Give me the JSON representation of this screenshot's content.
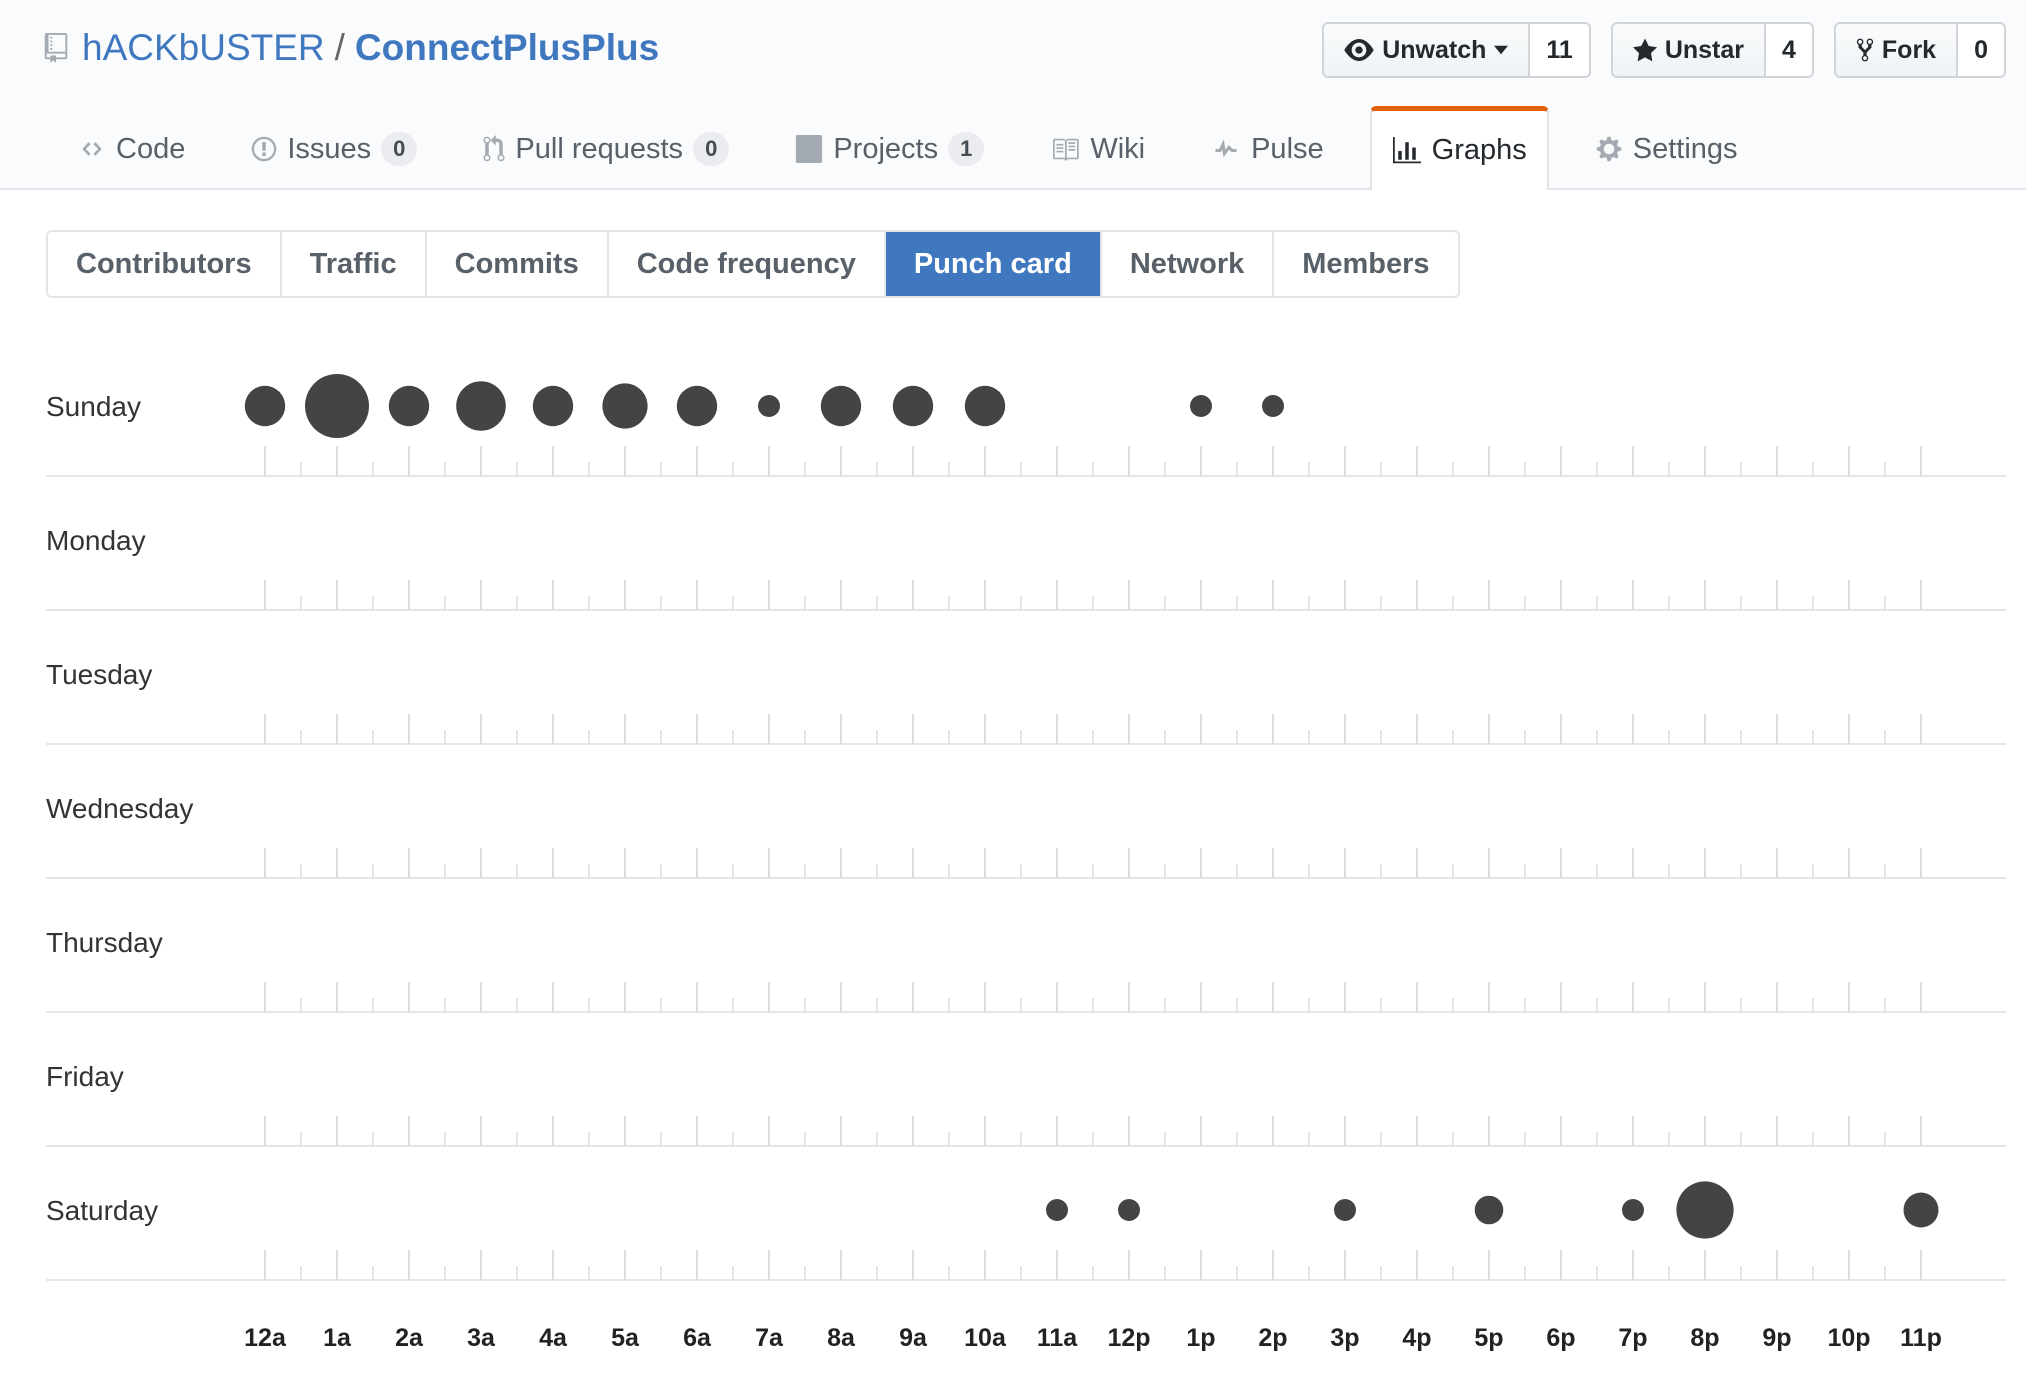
{
  "repo": {
    "owner": "hACKbUSTER",
    "separator": "/",
    "name": "ConnectPlusPlus"
  },
  "actions": {
    "watch": {
      "label": "Unwatch",
      "count": "11"
    },
    "star": {
      "label": "Unstar",
      "count": "4"
    },
    "fork": {
      "label": "Fork",
      "count": "0"
    }
  },
  "reponav": {
    "code": {
      "label": "Code"
    },
    "issues": {
      "label": "Issues",
      "count": "0"
    },
    "pulls": {
      "label": "Pull requests",
      "count": "0"
    },
    "projects": {
      "label": "Projects",
      "count": "1"
    },
    "wiki": {
      "label": "Wiki"
    },
    "pulse": {
      "label": "Pulse"
    },
    "graphs": {
      "label": "Graphs"
    },
    "settings": {
      "label": "Settings"
    }
  },
  "subnav": {
    "contributors": "Contributors",
    "traffic": "Traffic",
    "commits": "Commits",
    "code_frequency": "Code frequency",
    "punch_card": "Punch card",
    "network": "Network",
    "members": "Members"
  },
  "colors": {
    "link": "#4078c0",
    "accent": "#e36209",
    "selected": "#4078c0",
    "dot": "#444444"
  },
  "chart_data": {
    "type": "scatter",
    "days": [
      "Sunday",
      "Monday",
      "Tuesday",
      "Wednesday",
      "Thursday",
      "Friday",
      "Saturday"
    ],
    "hours": [
      "12a",
      "1a",
      "2a",
      "3a",
      "4a",
      "5a",
      "6a",
      "7a",
      "8a",
      "9a",
      "10a",
      "11a",
      "12p",
      "1p",
      "2p",
      "3p",
      "4p",
      "5p",
      "6p",
      "7p",
      "8p",
      "9p",
      "10p",
      "11p"
    ],
    "values": [
      [
        4,
        10,
        4,
        6,
        4,
        5,
        4,
        1,
        4,
        4,
        4,
        0,
        0,
        1,
        1,
        0,
        0,
        0,
        0,
        0,
        0,
        0,
        0,
        0
      ],
      [
        0,
        0,
        0,
        0,
        0,
        0,
        0,
        0,
        0,
        0,
        0,
        0,
        0,
        0,
        0,
        0,
        0,
        0,
        0,
        0,
        0,
        0,
        0,
        0
      ],
      [
        0,
        0,
        0,
        0,
        0,
        0,
        0,
        0,
        0,
        0,
        0,
        0,
        0,
        0,
        0,
        0,
        0,
        0,
        0,
        0,
        0,
        0,
        0,
        0
      ],
      [
        0,
        0,
        0,
        0,
        0,
        0,
        0,
        0,
        0,
        0,
        0,
        0,
        0,
        0,
        0,
        0,
        0,
        0,
        0,
        0,
        0,
        0,
        0,
        0
      ],
      [
        0,
        0,
        0,
        0,
        0,
        0,
        0,
        0,
        0,
        0,
        0,
        0,
        0,
        0,
        0,
        0,
        0,
        0,
        0,
        0,
        0,
        0,
        0,
        0
      ],
      [
        0,
        0,
        0,
        0,
        0,
        0,
        0,
        0,
        0,
        0,
        0,
        0,
        0,
        0,
        0,
        0,
        0,
        0,
        0,
        0,
        0,
        0,
        0,
        0
      ],
      [
        0,
        0,
        0,
        0,
        0,
        0,
        0,
        0,
        0,
        0,
        0,
        1,
        1,
        0,
        0,
        1,
        0,
        2,
        0,
        1,
        8,
        0,
        0,
        3
      ]
    ]
  }
}
